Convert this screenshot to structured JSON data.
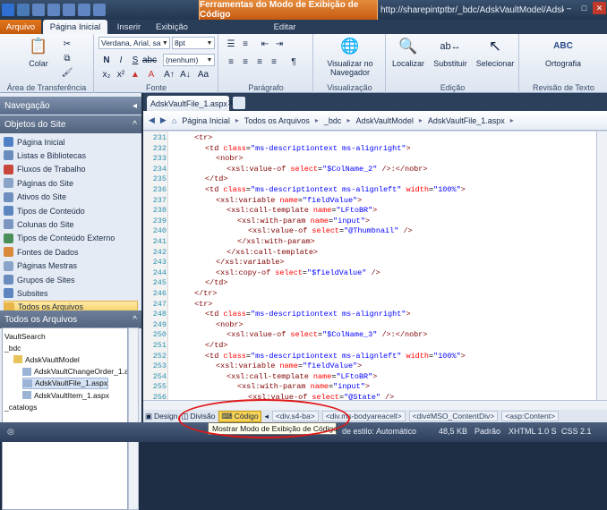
{
  "window": {
    "context_tab": "Ferramentas do Modo de Exibição de Código",
    "title": "http://sharepintptbr/_bdc/AdskVaultModel/AdskV...",
    "controls": [
      "–",
      "□",
      "✕"
    ]
  },
  "ribbon_tabs": [
    {
      "label": "Arquivo"
    },
    {
      "label": "Página Inicial"
    },
    {
      "label": "Inserir"
    },
    {
      "label": "Exibição"
    },
    {
      "label": "Editar"
    }
  ],
  "ribbon": {
    "clipboard": {
      "group": "Área de Transferência",
      "paste": "Colar"
    },
    "font": {
      "group": "Fonte",
      "family": "Verdana, Arial, sa",
      "size": "8pt",
      "style": "(nenhum)"
    },
    "paragraph": {
      "group": "Parágrafo"
    },
    "view": {
      "group": "Visualização",
      "preview": "Visualizar no Navegador"
    },
    "edit": {
      "group": "Edição",
      "find": "Localizar",
      "replace": "Substituir",
      "select": "Selecionar"
    },
    "proof": {
      "group": "Revisão de Texto",
      "spelling": "Ortografia",
      "icon": "ABC"
    }
  },
  "nav": {
    "header": "Navegação",
    "section": "Objetos do Site",
    "items": [
      {
        "label": "Página Inicial",
        "color": "#4f7fc4"
      },
      {
        "label": "Listas e Bibliotecas",
        "color": "#6a8dbd"
      },
      {
        "label": "Fluxos de Trabalho",
        "color": "#c9473a"
      },
      {
        "label": "Páginas do Site",
        "color": "#8aa4c9"
      },
      {
        "label": "Ativos do Site",
        "color": "#6e8fbf"
      },
      {
        "label": "Tipos de Conteúdo",
        "color": "#5d85c0"
      },
      {
        "label": "Colunas do Site",
        "color": "#7b96c0"
      },
      {
        "label": "Tipos de Conteúdo Externo",
        "color": "#4a8f5a"
      },
      {
        "label": "Fontes de Dados",
        "color": "#d9893a"
      },
      {
        "label": "Páginas Mestras",
        "color": "#8aa4c9"
      },
      {
        "label": "Grupos de Sites",
        "color": "#6a8dbd"
      },
      {
        "label": "Subsites",
        "color": "#5d85c0"
      },
      {
        "label": "Todos os Arquivos",
        "color": "#e7b54a",
        "selected": true
      }
    ],
    "tree_header": "Todos os Arquivos",
    "tree": [
      {
        "label": "VaultSearch",
        "level": 0
      },
      {
        "label": "_bdc",
        "level": 0
      },
      {
        "label": "AdskVaultModel",
        "level": 1
      },
      {
        "label": "AdskVaultChangeOrder_1.asp",
        "level": 2
      },
      {
        "label": "AdskVaultFile_1.aspx",
        "level": 2,
        "selected": true
      },
      {
        "label": "AdskVaultItem_1.aspx",
        "level": 2
      },
      {
        "label": "_catalogs",
        "level": 0
      }
    ]
  },
  "document": {
    "tab": "AdskVaultFile_1.aspx",
    "breadcrumb": [
      "Página Inicial",
      "Todos os Arquivos",
      "_bdc",
      "AdskVaultModel",
      "AdskVaultFile_1.aspx"
    ],
    "lines": [
      {
        "n": "231",
        "i": 4,
        "s": [
          [
            "t",
            "<tr>"
          ]
        ]
      },
      {
        "n": "232",
        "i": 6,
        "s": [
          [
            "t",
            "<td "
          ],
          [
            "a",
            "class"
          ],
          [
            "x",
            "="
          ],
          [
            "v",
            "\"ms-descriptiontext ms-alignright\""
          ],
          [
            "t",
            ">"
          ]
        ]
      },
      {
        "n": "233",
        "i": 8,
        "s": [
          [
            "t",
            "<nobr>"
          ]
        ]
      },
      {
        "n": "234",
        "i": 10,
        "s": [
          [
            "t",
            "<xsl:value-of "
          ],
          [
            "a",
            "select"
          ],
          [
            "x",
            "="
          ],
          [
            "v",
            "\"$ColName_2\""
          ],
          [
            "t",
            " />:</nobr>"
          ]
        ]
      },
      {
        "n": "235",
        "i": 6,
        "s": [
          [
            "t",
            "</td>"
          ]
        ]
      },
      {
        "n": "236",
        "i": 6,
        "s": [
          [
            "t",
            "<td "
          ],
          [
            "a",
            "class"
          ],
          [
            "x",
            "="
          ],
          [
            "v",
            "\"ms-descriptiontext ms-alignleft\""
          ],
          [
            "x",
            " "
          ],
          [
            "a",
            "width"
          ],
          [
            "x",
            "="
          ],
          [
            "v",
            "\"100%\""
          ],
          [
            "t",
            ">"
          ]
        ]
      },
      {
        "n": "237",
        "i": 8,
        "s": [
          [
            "t",
            "<xsl:variable "
          ],
          [
            "a",
            "name"
          ],
          [
            "x",
            "="
          ],
          [
            "v",
            "\"fieldValue\""
          ],
          [
            "t",
            ">"
          ]
        ]
      },
      {
        "n": "238",
        "i": 10,
        "s": [
          [
            "t",
            "<xsl:call-template "
          ],
          [
            "a",
            "name"
          ],
          [
            "x",
            "="
          ],
          [
            "v",
            "\"LFtoBR\""
          ],
          [
            "t",
            ">"
          ]
        ]
      },
      {
        "n": "239",
        "i": 12,
        "s": [
          [
            "t",
            "<xsl:with-param "
          ],
          [
            "a",
            "name"
          ],
          [
            "x",
            "="
          ],
          [
            "v",
            "\"input\""
          ],
          [
            "t",
            ">"
          ]
        ]
      },
      {
        "n": "240",
        "i": 14,
        "s": [
          [
            "t",
            "<xsl:value-of "
          ],
          [
            "a",
            "select"
          ],
          [
            "x",
            "="
          ],
          [
            "v",
            "\"@Thumbnail\""
          ],
          [
            "t",
            " />"
          ]
        ]
      },
      {
        "n": "241",
        "i": 12,
        "s": [
          [
            "t",
            "</xsl:with-param>"
          ]
        ]
      },
      {
        "n": "242",
        "i": 10,
        "s": [
          [
            "t",
            "</xsl:call-template>"
          ]
        ]
      },
      {
        "n": "243",
        "i": 8,
        "s": [
          [
            "t",
            "</xsl:variable>"
          ]
        ]
      },
      {
        "n": "244",
        "i": 8,
        "s": [
          [
            "t",
            "<xsl:copy-of "
          ],
          [
            "a",
            "select"
          ],
          [
            "x",
            "="
          ],
          [
            "v",
            "\"$fieldValue\""
          ],
          [
            "t",
            " />"
          ]
        ]
      },
      {
        "n": "245",
        "i": 6,
        "s": [
          [
            "t",
            "</td>"
          ]
        ]
      },
      {
        "n": "246",
        "i": 4,
        "s": [
          [
            "t",
            "</tr>"
          ]
        ]
      },
      {
        "n": "247",
        "i": 4,
        "s": [
          [
            "t",
            "<tr>"
          ]
        ]
      },
      {
        "n": "248",
        "i": 6,
        "s": [
          [
            "t",
            "<td "
          ],
          [
            "a",
            "class"
          ],
          [
            "x",
            "="
          ],
          [
            "v",
            "\"ms-descriptiontext ms-alignright\""
          ],
          [
            "t",
            ">"
          ]
        ]
      },
      {
        "n": "249",
        "i": 8,
        "s": [
          [
            "t",
            "<nobr>"
          ]
        ]
      },
      {
        "n": "250",
        "i": 10,
        "s": [
          [
            "t",
            "<xsl:value-of "
          ],
          [
            "a",
            "select"
          ],
          [
            "x",
            "="
          ],
          [
            "v",
            "\"$ColName_3\""
          ],
          [
            "t",
            " />:</nobr>"
          ]
        ]
      },
      {
        "n": "251",
        "i": 6,
        "s": [
          [
            "t",
            "</td>"
          ]
        ]
      },
      {
        "n": "252",
        "i": 6,
        "s": [
          [
            "t",
            "<td "
          ],
          [
            "a",
            "class"
          ],
          [
            "x",
            "="
          ],
          [
            "v",
            "\"ms-descriptiontext ms-alignleft\""
          ],
          [
            "x",
            " "
          ],
          [
            "a",
            "width"
          ],
          [
            "x",
            "="
          ],
          [
            "v",
            "\"100%\""
          ],
          [
            "t",
            ">"
          ]
        ]
      },
      {
        "n": "253",
        "i": 8,
        "s": [
          [
            "t",
            "<xsl:variable "
          ],
          [
            "a",
            "name"
          ],
          [
            "x",
            "="
          ],
          [
            "v",
            "\"fieldValue\""
          ],
          [
            "t",
            ">"
          ]
        ]
      },
      {
        "n": "254",
        "i": 10,
        "s": [
          [
            "t",
            "<xsl:call-template "
          ],
          [
            "a",
            "name"
          ],
          [
            "x",
            "="
          ],
          [
            "v",
            "\"LFtoBR\""
          ],
          [
            "t",
            ">"
          ]
        ]
      },
      {
        "n": "255",
        "i": 12,
        "s": [
          [
            "t",
            "<xsl:with-param "
          ],
          [
            "a",
            "name"
          ],
          [
            "x",
            "="
          ],
          [
            "v",
            "\"input\""
          ],
          [
            "t",
            ">"
          ]
        ]
      },
      {
        "n": "256",
        "i": 14,
        "s": [
          [
            "t",
            "<xsl:value-of "
          ],
          [
            "a",
            "select"
          ],
          [
            "x",
            "="
          ],
          [
            "v",
            "\"@State\""
          ],
          [
            "t",
            " />"
          ]
        ]
      }
    ]
  },
  "viewbar": {
    "design": "Design",
    "split": "Divisão",
    "code": "Código",
    "tags": [
      "<div.s4-ba>",
      "<div.ms-bodyareacell>",
      "<div#MSO_ContentDiv>",
      "<asp:Content>"
    ]
  },
  "tooltip": "Mostrar Modo de Exibição de Código",
  "status": {
    "style": "de estilo: Automático",
    "size": "48,5 KB",
    "mode": "Padrão",
    "doctype": "XHTML 1.0 S",
    "css": "CSS 2.1"
  }
}
